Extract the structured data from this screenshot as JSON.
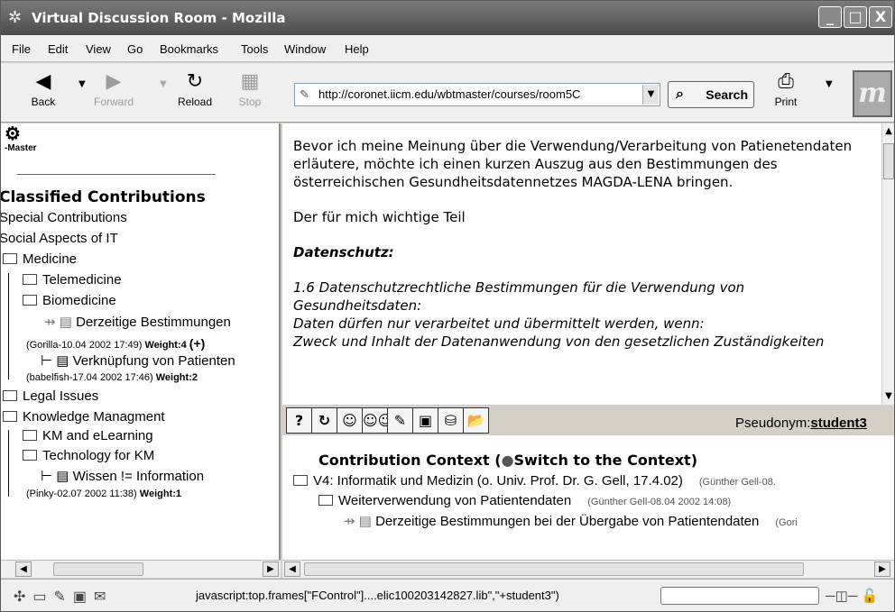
{
  "window": {
    "title": "Virtual Discussion Room - Mozilla",
    "controls": [
      "_",
      "□",
      "X"
    ]
  },
  "menubar": [
    "File",
    "Edit",
    "View",
    "Go",
    "Bookmarks",
    "Tools",
    "Window",
    "Help"
  ],
  "toolbar": {
    "back": "Back",
    "forward": "Forward",
    "reload": "Reload",
    "stop": "Stop",
    "url": "http://coronet.iicm.edu/wbtmaster/courses/room5C",
    "search": "Search",
    "print": "Print",
    "logo_text": "m"
  },
  "sidebar": {
    "logo_text": "-Master",
    "heading": "Classified Contributions",
    "items": {
      "special": "Special Contributions",
      "social": "Social Aspects of IT",
      "medicine": "Medicine",
      "telemedicine": "Telemedicine",
      "biomedicine": "Biomedicine",
      "derzeitige": "Derzeitige Bestimmungen",
      "derzeitige_meta": "(Gorilla-10.04 2002 17:49)",
      "derzeitige_weight": "Weight:4",
      "plus": "(+)",
      "verknuepfung": "Verknüpfung von Patienten",
      "verknuepfung_meta": "(babelfish-17.04 2002 17:46)",
      "verknuepfung_weight": "Weight:2",
      "legal": "Legal Issues",
      "knowledge": "Knowledge Managment",
      "km_elearning": "KM and eLearning",
      "tech_km": "Technology for KM",
      "wissen": "Wissen != Information",
      "wissen_meta": "(Pinky-02.07 2002 11:38)",
      "wissen_weight": "Weight:1"
    }
  },
  "content": {
    "p1": "Bevor ich meine Meinung über die Verwendung/Verarbeitung von Patienetendaten erläutere, möchte ich einen kurzen Auszug aus den Bestimmungen des österreichischen Gesundheitsdatennetzes MAGDA-LENA bringen.",
    "p2": "Der für mich wichtige Teil",
    "p3": "Datenschutz:",
    "p4": "1.6 Datenschutzrechtliche Bestimmungen für die Verwendung von Gesundheitsdaten:",
    "p5": "Daten dürfen nur verarbeitet und übermittelt werden, wenn:",
    "p6": "Zweck und Inhalt der Datenanwendung von den gesetzlichen Zuständigkeiten"
  },
  "iconbar": [
    "?",
    "↻",
    "☺",
    "☺☺",
    "✎",
    "▣",
    "⛁",
    "📂"
  ],
  "pseudonym": {
    "label": "Pseudonym:",
    "value": "student3"
  },
  "context": {
    "title_pre": "Contribution Context (",
    "title_link": "Switch to the Context",
    "title_post": ")",
    "l1": "V4: Informatik und Medizin (o. Univ. Prof. Dr. G. Gell, 17.4.02)",
    "l1_meta": "(Günther Gell-08.",
    "l2": "Weiterverwendung von Patientendaten",
    "l2_meta": "(Günther Gell-08.04 2002 14:08)",
    "l3": "Derzeitige Bestimmungen bei der Übergabe von Patientendaten",
    "l3_meta": "(Gori"
  },
  "statusbar": {
    "message": "javascript:top.frames[\"FControl\"]....elic100203142827.lib\",\"+student3\")"
  }
}
